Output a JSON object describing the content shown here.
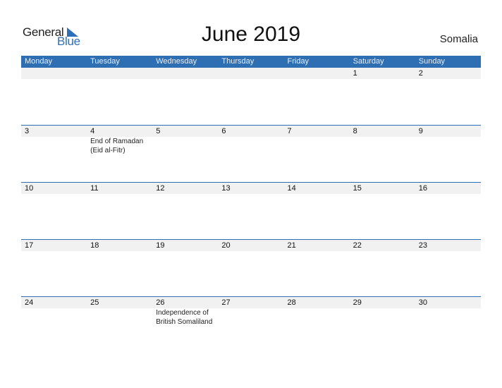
{
  "logo": {
    "general": "General",
    "blue": "Blue"
  },
  "title": "June 2019",
  "country": "Somalia",
  "weekdays": [
    "Monday",
    "Tuesday",
    "Wednesday",
    "Thursday",
    "Friday",
    "Saturday",
    "Sunday"
  ],
  "weeks": [
    {
      "days": [
        "",
        "",
        "",
        "",
        "",
        "1",
        "2"
      ],
      "events": [
        "",
        "",
        "",
        "",
        "",
        "",
        ""
      ]
    },
    {
      "days": [
        "3",
        "4",
        "5",
        "6",
        "7",
        "8",
        "9"
      ],
      "events": [
        "",
        "End of Ramadan (Eid al-Fitr)",
        "",
        "",
        "",
        "",
        ""
      ]
    },
    {
      "days": [
        "10",
        "11",
        "12",
        "13",
        "14",
        "15",
        "16"
      ],
      "events": [
        "",
        "",
        "",
        "",
        "",
        "",
        ""
      ]
    },
    {
      "days": [
        "17",
        "18",
        "19",
        "20",
        "21",
        "22",
        "23"
      ],
      "events": [
        "",
        "",
        "",
        "",
        "",
        "",
        ""
      ]
    },
    {
      "days": [
        "24",
        "25",
        "26",
        "27",
        "28",
        "29",
        "30"
      ],
      "events": [
        "",
        "",
        "Independence of British Somaliland",
        "",
        "",
        "",
        ""
      ]
    }
  ],
  "colors": {
    "accent": "#2e6fb3",
    "band": "#f1f1f1"
  }
}
